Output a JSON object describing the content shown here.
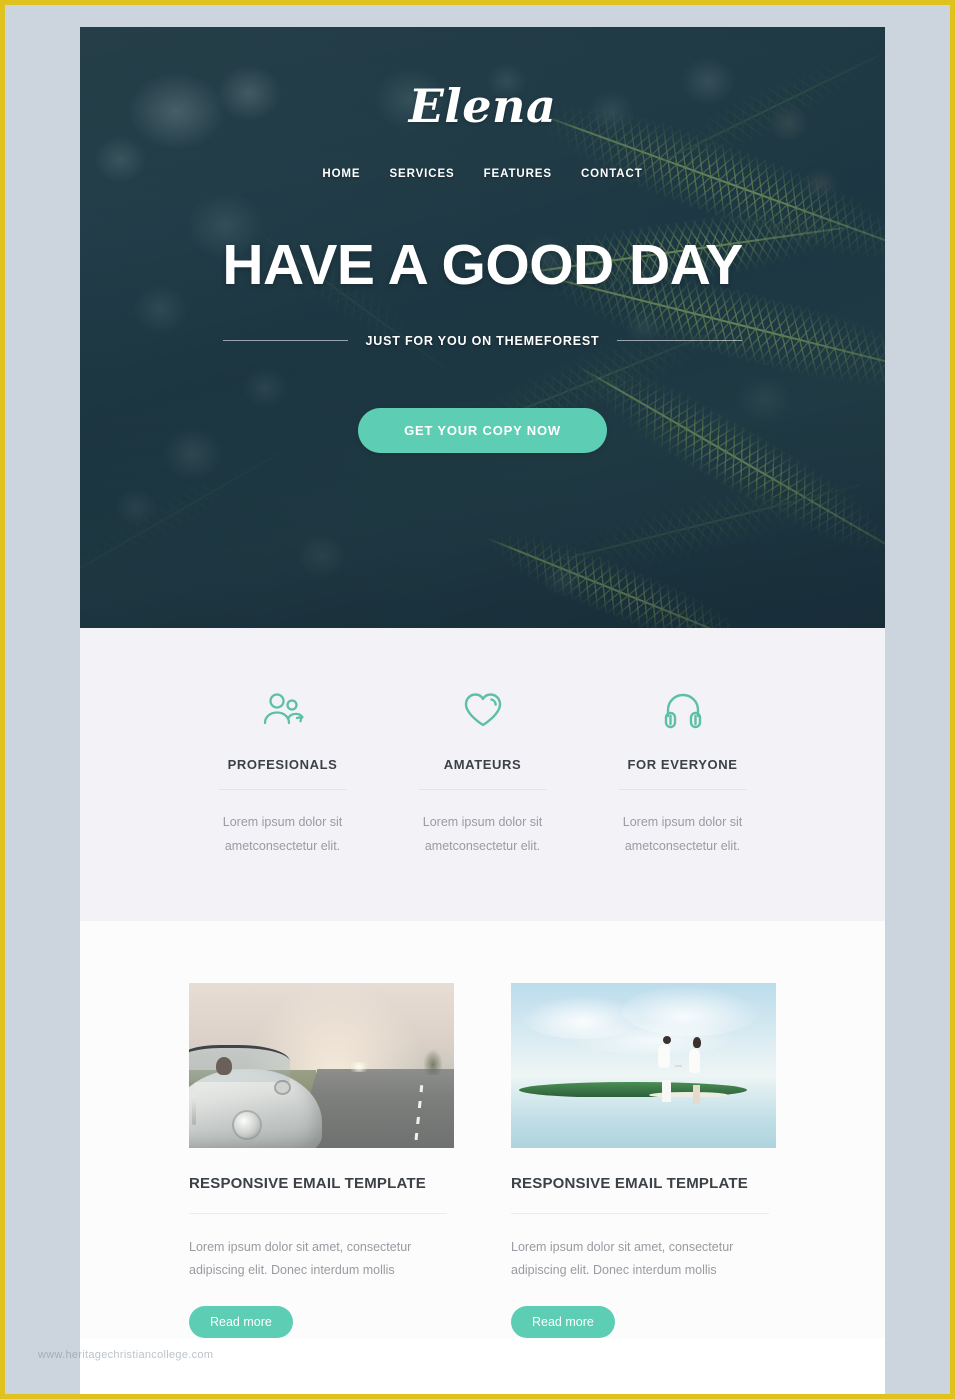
{
  "brand": {
    "name": "Elena"
  },
  "nav": {
    "items": [
      {
        "label": "HOME"
      },
      {
        "label": "SERVICES"
      },
      {
        "label": "FEATURES"
      },
      {
        "label": "CONTACT"
      }
    ]
  },
  "hero": {
    "title": "HAVE A GOOD DAY",
    "subtitle": "JUST FOR YOU ON THEMEFOREST",
    "cta_label": "GET YOUR COPY NOW",
    "background_description": "pine conifer branches, dark teal, bokeh"
  },
  "features": {
    "items": [
      {
        "icon": "users-icon",
        "title": "PROFESIONALS",
        "text": "Lorem ipsum dolor sit ametconsectetur elit."
      },
      {
        "icon": "heart-icon",
        "title": "AMATEURS",
        "text": "Lorem ipsum dolor sit ametconsectetur elit."
      },
      {
        "icon": "headphones-icon",
        "title": "FOR EVERYONE",
        "text": "Lorem ipsum dolor sit ametconsectetur elit."
      }
    ]
  },
  "cards": {
    "items": [
      {
        "image": "vintage-convertible-car-on-road",
        "title": "RESPONSIVE EMAIL TEMPLATE",
        "text": "Lorem ipsum dolor sit amet, consectetur adipiscing elit. Donec interdum mollis",
        "button_label": "Read more"
      },
      {
        "image": "couple-walking-on-tropical-sandbar",
        "title": "RESPONSIVE EMAIL TEMPLATE",
        "text": "Lorem ipsum dolor sit amet, consectetur adipiscing elit. Donec interdum mollis",
        "button_label": "Read more"
      }
    ]
  },
  "watermark": {
    "text": "www.heritagechristiancollege.com"
  },
  "colors": {
    "accent": "#5dcdb4",
    "hero_dark": "#21404d",
    "feature_bg": "#f3f3f7",
    "card_bg": "#fcfcfc",
    "page_bg": "#ccd5de",
    "page_border": "#e0c21e",
    "heading": "#3c4147",
    "body_text": "#9a9aa2"
  }
}
